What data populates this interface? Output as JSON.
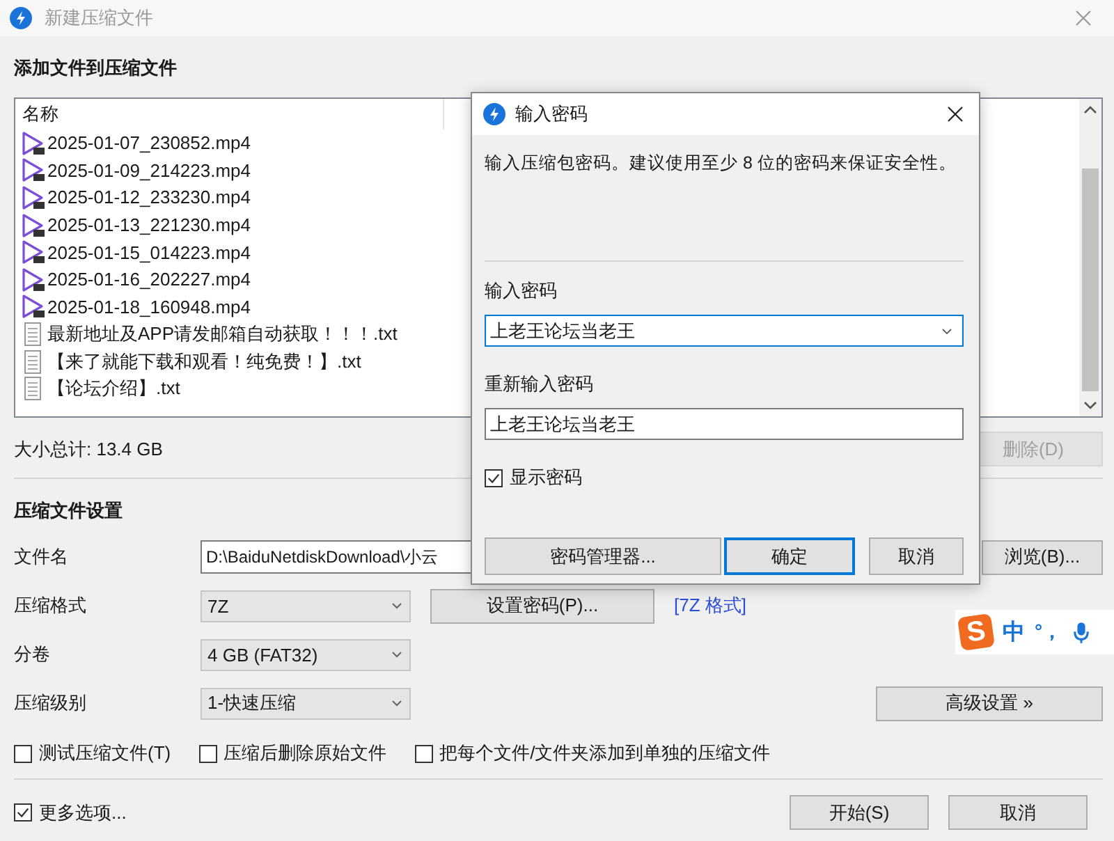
{
  "window": {
    "title": "新建压缩文件"
  },
  "files_section": {
    "heading": "添加文件到压缩文件",
    "column_1": "名称",
    "files": [
      {
        "name": "2025-01-07_230852.mp4",
        "kind": "video"
      },
      {
        "name": "2025-01-09_214223.mp4",
        "kind": "video"
      },
      {
        "name": "2025-01-12_233230.mp4",
        "kind": "video"
      },
      {
        "name": "2025-01-13_221230.mp4",
        "kind": "video"
      },
      {
        "name": "2025-01-15_014223.mp4",
        "kind": "video"
      },
      {
        "name": "2025-01-16_202227.mp4",
        "kind": "video"
      },
      {
        "name": "2025-01-18_160948.mp4",
        "kind": "video"
      },
      {
        "name": "最新地址及APP请发邮箱自动获取！！！.txt",
        "kind": "text"
      },
      {
        "name": "【来了就能下载和观看！纯免费！】.txt",
        "kind": "text"
      },
      {
        "name": "【论坛介绍】.txt",
        "kind": "text"
      }
    ],
    "total": "大小总计: 13.4 GB",
    "delete_button": {
      "label": "删除(D)",
      "disabled": true
    }
  },
  "settings": {
    "heading": "压缩文件设置",
    "filename": {
      "label": "文件名",
      "value": "D:\\BaiduNetdiskDownload\\小云"
    },
    "browse_button": "浏览(B)...",
    "format": {
      "label": "压缩格式",
      "value": "7Z"
    },
    "set_password_button": "设置密码(P)...",
    "format_link": "[7Z 格式]",
    "volume": {
      "label": "分卷",
      "value": "4 GB (FAT32)"
    },
    "level": {
      "label": "压缩级别",
      "value": "1-快速压缩"
    },
    "advanced_button": "高级设置 »",
    "options": [
      {
        "label": "测试压缩文件(T)",
        "checked": false
      },
      {
        "label": "压缩后删除原始文件",
        "checked": false
      },
      {
        "label": "把每个文件/文件夹添加到单独的压缩文件",
        "checked": false
      }
    ]
  },
  "more_options": {
    "label": "更多选项...",
    "checked": true
  },
  "buttons": [
    "开始(S)",
    "取消"
  ],
  "dialog": {
    "title": "输入密码",
    "description": "输入压缩包密码。建议使用至少 8 位的密码来保证安全性。",
    "password_label": "输入密码",
    "password_value": "上老王论坛当老王",
    "confirm_label": "重新输入密码",
    "confirm_value": "上老王论坛当老王",
    "show_password": {
      "label": "显示密码",
      "checked": true
    },
    "manager_button": "密码管理器...",
    "ok_button": "确定",
    "cancel_button": "取消"
  },
  "ime_toolbar": {
    "logo": "S",
    "mode": "中",
    "punctuation": "°，"
  }
}
